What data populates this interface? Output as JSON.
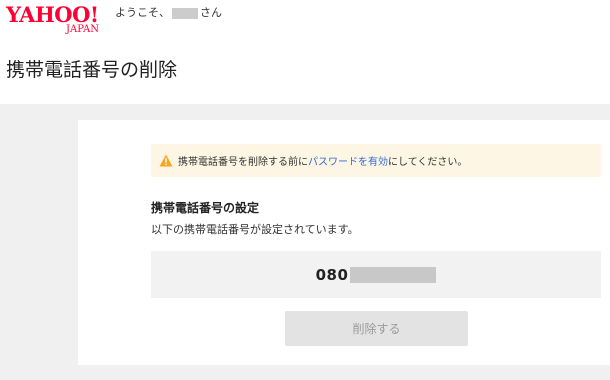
{
  "header": {
    "logo_main": "YAHOO!",
    "logo_sub": "JAPAN",
    "greeting_prefix": "ようこそ、",
    "greeting_suffix": "さん"
  },
  "page": {
    "title": "携帯電話番号の削除"
  },
  "warning": {
    "text_before": "携帯電話番号を削除する前に",
    "link_text": "パスワードを有効",
    "text_after": "にしてください。",
    "icon": "warning-triangle-icon",
    "accent_color": "#f5a623",
    "link_color": "#2f6bd8"
  },
  "settings": {
    "title": "携帯電話番号の設定",
    "description": "以下の携帯電話番号が設定されています。",
    "phone_prefix": "080"
  },
  "actions": {
    "delete_label": "削除する"
  }
}
